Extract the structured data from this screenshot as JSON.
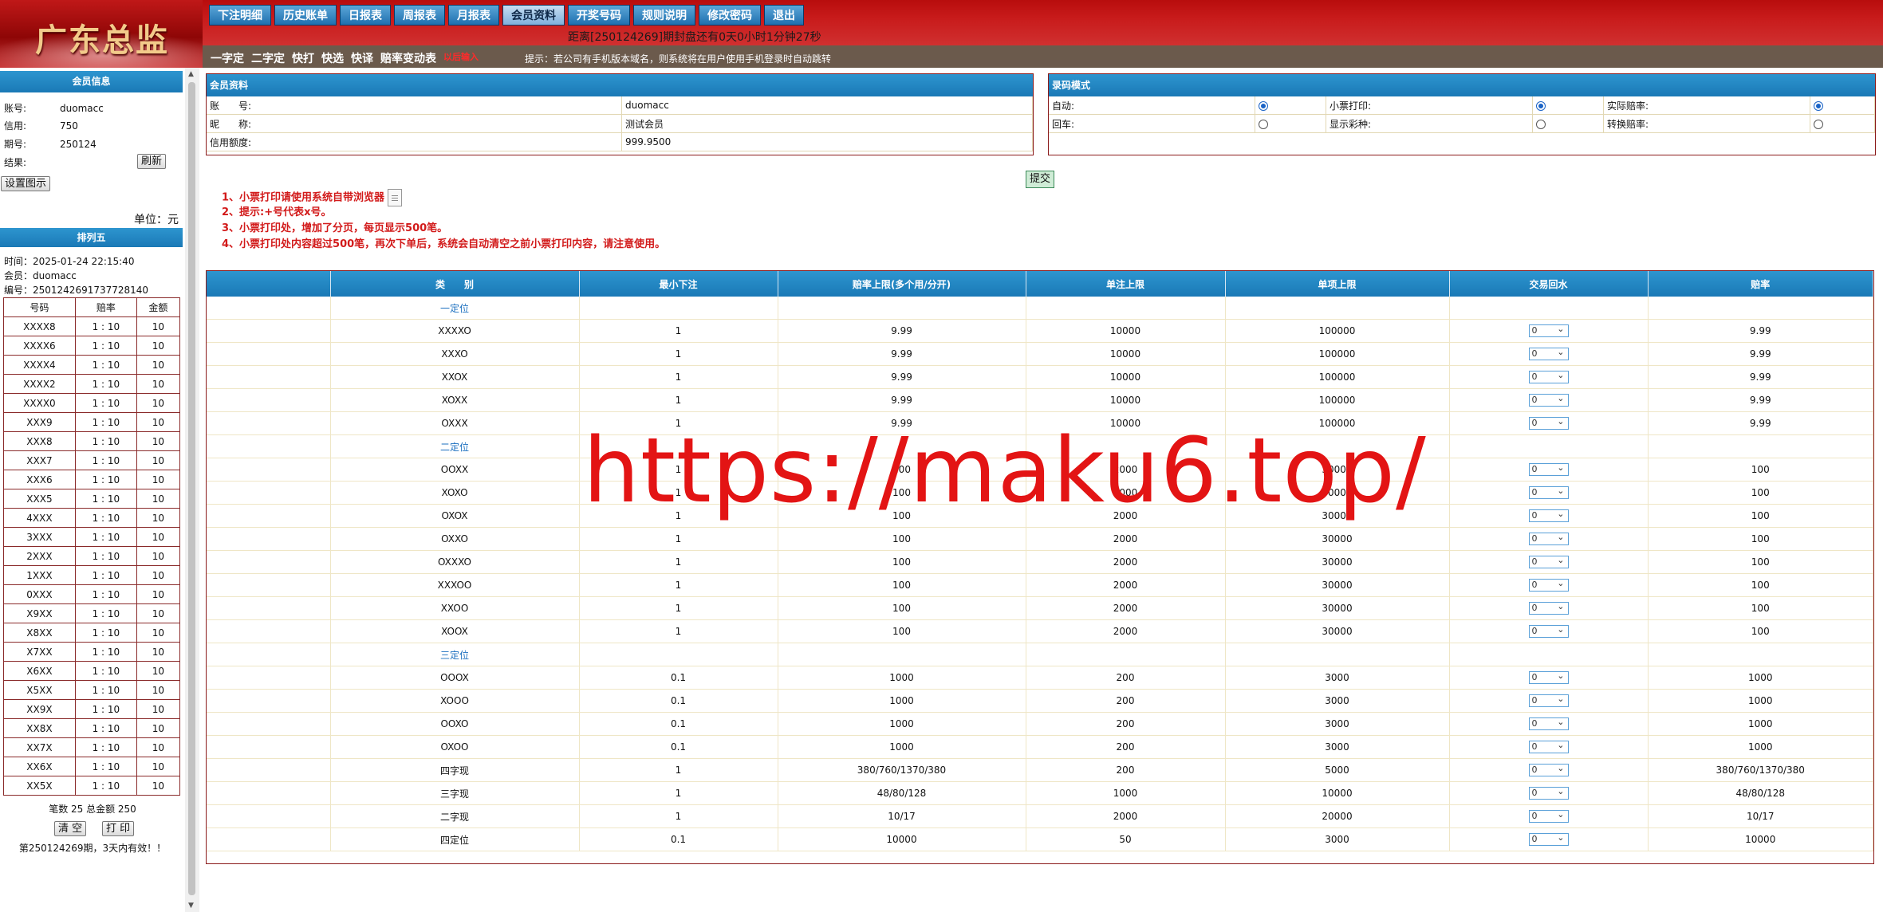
{
  "logo": {
    "text": "广东总监"
  },
  "nav": {
    "buttons": [
      "下注明细",
      "历史账单",
      "日报表",
      "周报表",
      "月报表",
      "会员资料",
      "开奖号码",
      "规则说明",
      "修改密码",
      "退出"
    ],
    "active": "会员资料"
  },
  "countdown": "距离[250124269]期封盘还有0天0小时1分钟27秒",
  "subbar": {
    "links": [
      "一字定",
      "二字定",
      "快打",
      "快选",
      "快译",
      "赔率变动表"
    ],
    "red_link": "以后输入",
    "tip": "提示：若公司有手机版本域名，则系统将在用户使用手机登录时自动跳转"
  },
  "sidebar": {
    "member_info_title": "会员信息",
    "account_label": "账号:",
    "account": "duomacc",
    "credit_label": "信用:",
    "credit": "750",
    "period_label": "期号:",
    "period": "250124",
    "result_label": "结果:",
    "refresh_label": "刷新",
    "settings_label": "设置图示",
    "unit_label": "单位：元",
    "rank_title": "排列五",
    "time_line": "时间：2025-01-24 22:15:40",
    "member_line": "会员：duomacc",
    "serial_line": "编号：2501242691737728140",
    "table_headers": [
      "号码",
      "赔率",
      "金额"
    ],
    "rows": [
      [
        "XXXX8",
        "1 : 10",
        "10"
      ],
      [
        "XXXX6",
        "1 : 10",
        "10"
      ],
      [
        "XXXX4",
        "1 : 10",
        "10"
      ],
      [
        "XXXX2",
        "1 : 10",
        "10"
      ],
      [
        "XXXX0",
        "1 : 10",
        "10"
      ],
      [
        "XXX9",
        "1 : 10",
        "10"
      ],
      [
        "XXX8",
        "1 : 10",
        "10"
      ],
      [
        "XXX7",
        "1 : 10",
        "10"
      ],
      [
        "XXX6",
        "1 : 10",
        "10"
      ],
      [
        "XXX5",
        "1 : 10",
        "10"
      ],
      [
        "4XXX",
        "1 : 10",
        "10"
      ],
      [
        "3XXX",
        "1 : 10",
        "10"
      ],
      [
        "2XXX",
        "1 : 10",
        "10"
      ],
      [
        "1XXX",
        "1 : 10",
        "10"
      ],
      [
        "0XXX",
        "1 : 10",
        "10"
      ],
      [
        "X9XX",
        "1 : 10",
        "10"
      ],
      [
        "X8XX",
        "1 : 10",
        "10"
      ],
      [
        "X7XX",
        "1 : 10",
        "10"
      ],
      [
        "X6XX",
        "1 : 10",
        "10"
      ],
      [
        "X5XX",
        "1 : 10",
        "10"
      ],
      [
        "XX9X",
        "1 : 10",
        "10"
      ],
      [
        "XX8X",
        "1 : 10",
        "10"
      ],
      [
        "XX7X",
        "1 : 10",
        "10"
      ],
      [
        "XX6X",
        "1 : 10",
        "10"
      ],
      [
        "XX5X",
        "1 : 10",
        "10"
      ]
    ],
    "summary": "笔数 25 总金额 250",
    "clear_label": "清 空",
    "print_label": "打 印",
    "footer": "第250124269期，3天内有效！！"
  },
  "member_panel": {
    "title": "会员资料",
    "rows": [
      {
        "label": "账　　号:",
        "value": "duomacc"
      },
      {
        "label": "昵　　称:",
        "value": "测试会员"
      },
      {
        "label": "信用额度:",
        "value": "999.9500"
      }
    ]
  },
  "mode_panel": {
    "title": "录码模式",
    "rows": [
      [
        {
          "label": "自动:",
          "on": true
        },
        {
          "label": "小票打印:",
          "on": true
        },
        {
          "label": "实际赔率:",
          "on": true
        }
      ],
      [
        {
          "label": "回车:",
          "on": false
        },
        {
          "label": "显示彩种:",
          "on": false
        },
        {
          "label": "转换赔率:",
          "on": false
        }
      ]
    ]
  },
  "submit_label": "提交",
  "notes": [
    "1、小票打印请使用系统自带浏览器",
    "2、提示:+号代表x号。",
    "3、小票打印处，增加了分页，每页显示500笔。",
    "4、小票打印处内容超过500笔，再次下单后，系统会自动清空之前小票打印内容，请注意使用。"
  ],
  "main_table": {
    "headers": [
      "",
      "类　　别",
      "最小下注",
      "赔率上限(多个用/分开)",
      "单注上限",
      "单项上限",
      "交易回水",
      "赔率"
    ],
    "groups": [
      {
        "name": "一定位",
        "rows": [
          [
            "XXXXO",
            "1",
            "9.99",
            "10000",
            "100000",
            "0",
            "9.99"
          ],
          [
            "XXXO",
            "1",
            "9.99",
            "10000",
            "100000",
            "0",
            "9.99"
          ],
          [
            "XXOX",
            "1",
            "9.99",
            "10000",
            "100000",
            "0",
            "9.99"
          ],
          [
            "XOXX",
            "1",
            "9.99",
            "10000",
            "100000",
            "0",
            "9.99"
          ],
          [
            "OXXX",
            "1",
            "9.99",
            "10000",
            "100000",
            "0",
            "9.99"
          ]
        ]
      },
      {
        "name": "二定位",
        "rows": [
          [
            "OOXX",
            "1",
            "100",
            "2000",
            "30000",
            "0",
            "100"
          ],
          [
            "XOXO",
            "1",
            "100",
            "2000",
            "30000",
            "0",
            "100"
          ],
          [
            "OXOX",
            "1",
            "100",
            "2000",
            "30000",
            "0",
            "100"
          ],
          [
            "OXXO",
            "1",
            "100",
            "2000",
            "30000",
            "0",
            "100"
          ],
          [
            "OXXXO",
            "1",
            "100",
            "2000",
            "30000",
            "0",
            "100"
          ],
          [
            "XXXOO",
            "1",
            "100",
            "2000",
            "30000",
            "0",
            "100"
          ],
          [
            "XXOO",
            "1",
            "100",
            "2000",
            "30000",
            "0",
            "100"
          ],
          [
            "XOOX",
            "1",
            "100",
            "2000",
            "30000",
            "0",
            "100"
          ]
        ]
      },
      {
        "name": "三定位",
        "rows": [
          [
            "OOOX",
            "0.1",
            "1000",
            "200",
            "3000",
            "0",
            "1000"
          ],
          [
            "XOOO",
            "0.1",
            "1000",
            "200",
            "3000",
            "0",
            "1000"
          ],
          [
            "OOXO",
            "0.1",
            "1000",
            "200",
            "3000",
            "0",
            "1000"
          ],
          [
            "OXOO",
            "0.1",
            "1000",
            "200",
            "3000",
            "0",
            "1000"
          ],
          [
            "四字现",
            "1",
            "380/760/1370/380",
            "200",
            "5000",
            "0",
            "380/760/1370/380"
          ],
          [
            "三字现",
            "1",
            "48/80/128",
            "1000",
            "10000",
            "0",
            "48/80/128"
          ],
          [
            "二字现",
            "1",
            "10/17",
            "2000",
            "20000",
            "0",
            "10/17"
          ],
          [
            "四定位",
            "0.1",
            "10000",
            "50",
            "3000",
            "0",
            "10000"
          ]
        ]
      }
    ]
  },
  "watermark": "https://maku6.top/",
  "colors": {
    "header_red": "#c81b1b",
    "accent_blue": "#1a79b6",
    "note_red": "#d21a1a",
    "border_red": "#8b1a1a"
  }
}
